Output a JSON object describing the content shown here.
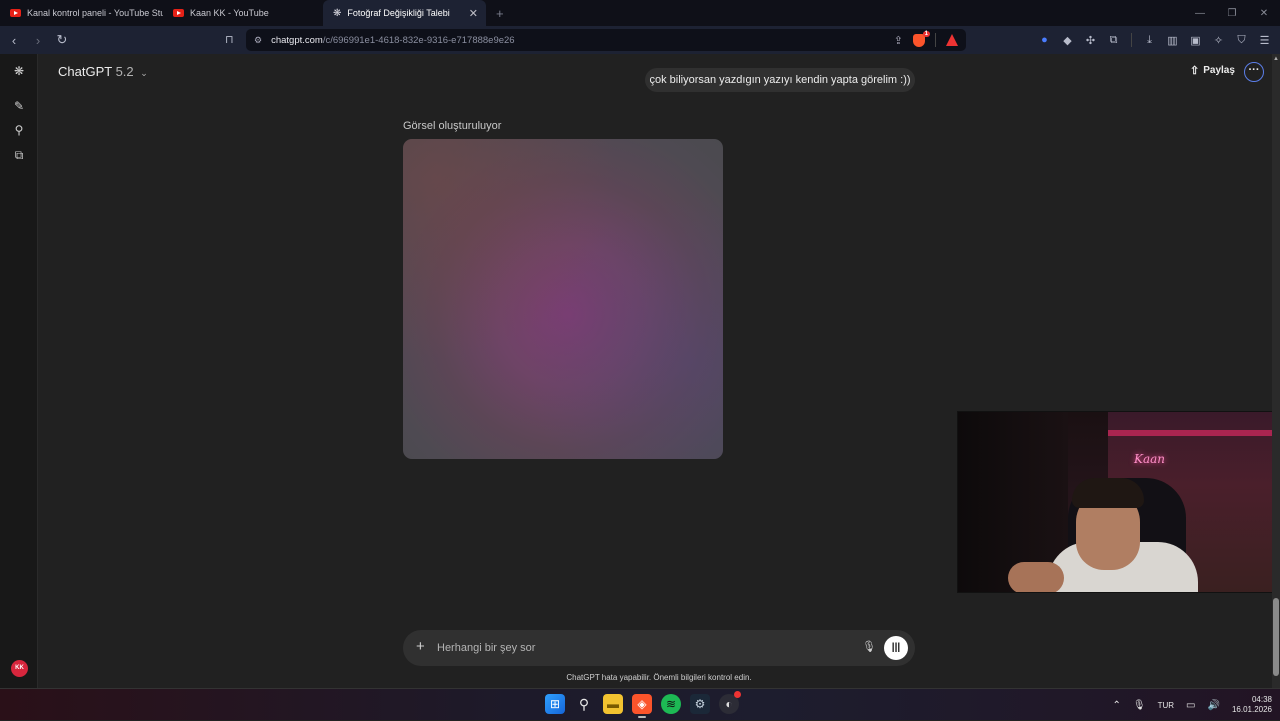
{
  "browser": {
    "tabs": [
      {
        "title": "Kanal kontrol paneli - YouTube Studio",
        "icon": "youtube-icon"
      },
      {
        "title": "Kaan KK - YouTube",
        "icon": "youtube-icon"
      },
      {
        "title": "Fotoğraf Değişikliği Talebi",
        "icon": "chatgpt-icon",
        "active": true
      }
    ],
    "new_tab": "+",
    "url_host": "chatgpt.com",
    "url_path": "/c/696991e1-4618-832e-9316-e717888e9e26",
    "brave_shield_count": "1",
    "rewards_count": "3"
  },
  "sidebar": {
    "avatar_initials": "KK"
  },
  "header": {
    "model_name": "ChatGPT",
    "model_version": "5.2",
    "share_label": "Paylaş"
  },
  "conversation": {
    "user_message": "çok biliyorsan yazdıgın yazıyı kendin yapta görelim :))",
    "generating_label": "Görsel oluşturuluyor"
  },
  "composer": {
    "placeholder": "Herhangi bir şey sor"
  },
  "disclaimer": "ChatGPT hata yapabilir. Önemli bilgileri kontrol edin.",
  "webcam": {
    "neon_text": "Kaan"
  },
  "taskbar": {
    "language": "TUR",
    "time": "04:38",
    "date": "16.01.2026"
  }
}
